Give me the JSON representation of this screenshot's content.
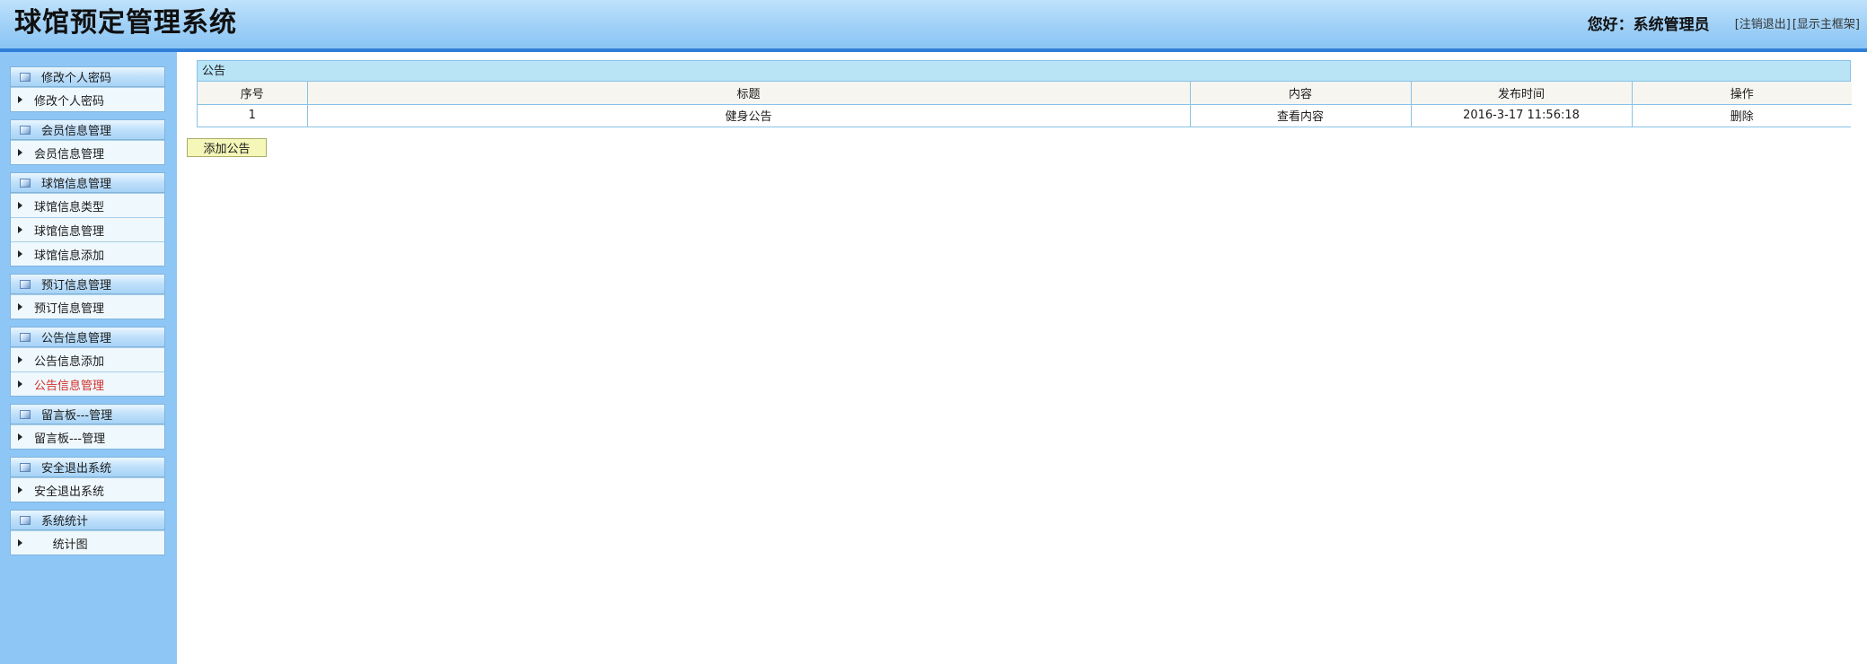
{
  "app": {
    "title": "球馆预定管理系统",
    "greeting": "您好：系统管理员",
    "logout_link": "[注销退出]",
    "show_frame_link": "[显示主框架]"
  },
  "sidebar": {
    "groups": [
      {
        "title": "修改个人密码",
        "items": [
          "修改个人密码"
        ]
      },
      {
        "title": "会员信息管理",
        "items": [
          "会员信息管理"
        ]
      },
      {
        "title": "球馆信息管理",
        "items": [
          "球馆信息类型",
          "球馆信息管理",
          "球馆信息添加"
        ]
      },
      {
        "title": "预订信息管理",
        "items": [
          "预订信息管理"
        ]
      },
      {
        "title": "公告信息管理",
        "items": [
          "公告信息添加",
          "公告信息管理"
        ]
      },
      {
        "title": "留言板---管理",
        "items": [
          "留言板---管理"
        ]
      },
      {
        "title": "安全退出系统",
        "items": [
          "安全退出系统"
        ]
      },
      {
        "title": "系统统计",
        "items": [
          "     统计图"
        ]
      }
    ],
    "active_item": "公告信息管理"
  },
  "main": {
    "panel_title": "公告",
    "columns": [
      "序号",
      "标题",
      "内容",
      "发布时间",
      "操作"
    ],
    "rows": [
      {
        "index": "1",
        "title": "健身公告",
        "content": "查看内容",
        "time": "2016-3-17 11:56:18",
        "action": "删除"
      }
    ],
    "add_button": "添加公告"
  },
  "colors": {
    "header_border": "#2f7fd8",
    "sidebar_bg": "#8ec6f6",
    "panel_title_bg": "#b8e4f6",
    "active_item": "#d4302a",
    "add_button_bg": "#f4f7b8"
  }
}
